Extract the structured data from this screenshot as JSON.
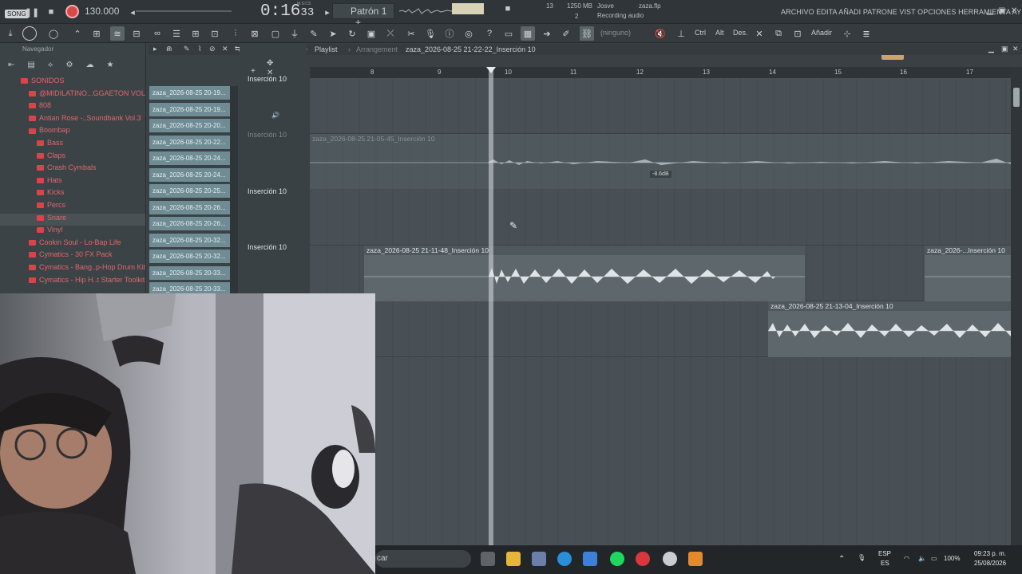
{
  "topbar": {
    "song_badge": "SONG",
    "tempo": "130.000",
    "time_main": "0:16",
    "time_sub": "33",
    "time_unit": "M:S:CS",
    "pattern": "Patrón 1",
    "cpu_count": "13",
    "memory": "1250 MB",
    "poly": "2",
    "user": "Josve",
    "hint": "Recording audio",
    "file": "zaza.flp",
    "menu": "ARCHIVO EDITA AÑADI PATRONE VIST OPCIONES HERRAMIENTA AY"
  },
  "toolbar": {
    "ninguno": "(ninguno)",
    "ctrl": "Ctrl",
    "alt": "Alt",
    "des": "Des.",
    "anadir": "Añadir"
  },
  "browser": {
    "title": "Navegador",
    "items": [
      {
        "label": "SONIDOS",
        "level": 0
      },
      {
        "label": "@MIDILATINO...GGAETON VOL. 1",
        "level": 1
      },
      {
        "label": "808",
        "level": 1
      },
      {
        "label": "Antian Rose -..Soundbank Vol.3",
        "level": 1
      },
      {
        "label": "Boombap",
        "level": 1
      },
      {
        "label": "Bass",
        "level": 2
      },
      {
        "label": "Claps",
        "level": 2
      },
      {
        "label": "Crash Cymbals",
        "level": 2
      },
      {
        "label": "Hats",
        "level": 2
      },
      {
        "label": "Kicks",
        "level": 2
      },
      {
        "label": "Percs",
        "level": 2
      },
      {
        "label": "Snare",
        "level": 2
      },
      {
        "label": "Vinyl",
        "level": 2
      },
      {
        "label": "Cookin Soul - Lo-Bap Life",
        "level": 1
      },
      {
        "label": "Cymatics - 30 FX Pack",
        "level": 1
      },
      {
        "label": "Cymatics - Bang..p-Hop Drum Kit",
        "level": 1
      },
      {
        "label": "Cymatics - Hip H..t Starter Toolkit",
        "level": 1
      }
    ],
    "selected_index": 11
  },
  "files": [
    "zaza_2026-08-25 20-19...",
    "zaza_2026-08-25 20-19...",
    "zaza_2026-08-25 20-20...",
    "zaza_2026-08-25 20-22...",
    "zaza_2026-08-25 20-24...",
    "zaza_2026-08-25 20-24...",
    "zaza_2026-08-25 20-25...",
    "zaza_2026-08-25 20-26...",
    "zaza_2026-08-25 20-26...",
    "zaza_2026-08-25 20-32...",
    "zaza_2026-08-25 20-32...",
    "zaza_2026-08-25 20-33...",
    "zaza_2026-08-25 20-33..."
  ],
  "playlist": {
    "title": "Playlist",
    "subtitle": "Arrangement",
    "current_clip": "zaza_2026-08-25 21-22-22_Inserción 10",
    "bars": [
      "8",
      "9",
      "10",
      "11",
      "12",
      "13",
      "14",
      "15",
      "16",
      "17"
    ],
    "tracks": [
      "Inserción 10",
      "Inserción 10",
      "Inserción 10",
      "Inserción 10"
    ],
    "clips": {
      "c1": "zaza_2026-08-25 21-05-45_Inserción 10",
      "c2": "zaza_2026-08-25 21-11-48_Inserción 10",
      "c3": "zaza_2026-...Inserción 10",
      "c4": "zaza_2026-08-25 21-13-04_Inserción 10"
    },
    "db_tip": "-8.6dB"
  },
  "taskbar": {
    "search": "car",
    "lang1": "ESP",
    "lang2": "ES",
    "battery": "100%",
    "time": "09:23 p. m.",
    "date": "25/08/2026"
  }
}
